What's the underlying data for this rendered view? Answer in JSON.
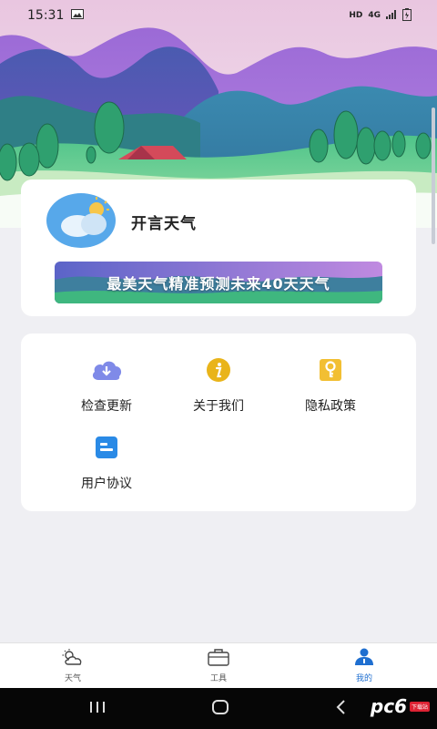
{
  "status_bar": {
    "time": "15:31",
    "indicators": [
      "HD",
      "4G"
    ],
    "icons": [
      "gallery-icon",
      "signal-icon",
      "battery-icon"
    ]
  },
  "app": {
    "name": "开言天气",
    "banner_text": "最美天气精准预测未来40天天气"
  },
  "menu": {
    "items": [
      {
        "label": "检查更新",
        "icon": "cloud-download-icon",
        "color": "#7f8ae8"
      },
      {
        "label": "关于我们",
        "icon": "info-icon",
        "color": "#e9b41a"
      },
      {
        "label": "隐私政策",
        "icon": "key-icon",
        "color": "#f2bf33"
      },
      {
        "label": "用户协议",
        "icon": "document-icon",
        "color": "#2a8ae6"
      }
    ]
  },
  "tab_bar": {
    "tabs": [
      {
        "label": "天气",
        "icon": "weather-icon",
        "active": false
      },
      {
        "label": "工具",
        "icon": "toolbox-icon",
        "active": false
      },
      {
        "label": "我的",
        "icon": "person-icon",
        "active": true
      }
    ],
    "active_color": "#1f6fd0"
  },
  "watermark": {
    "text": "pc6",
    "badge": "下载站"
  }
}
